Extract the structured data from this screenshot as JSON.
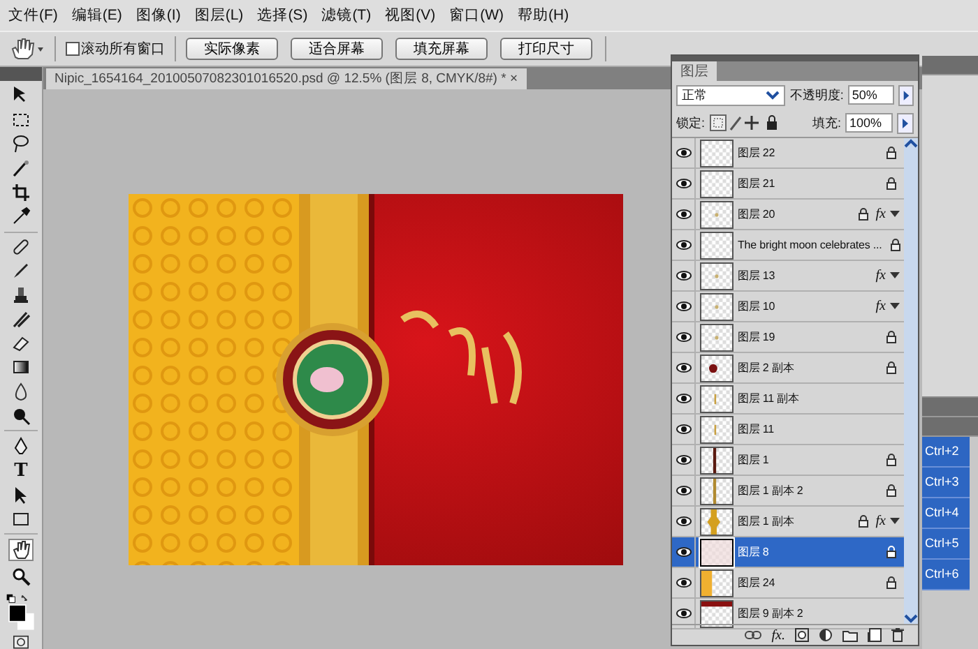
{
  "menu": [
    "文件(F)",
    "编辑(E)",
    "图像(I)",
    "图层(L)",
    "选择(S)",
    "滤镜(T)",
    "视图(V)",
    "窗口(W)",
    "帮助(H)"
  ],
  "options_bar": {
    "scroll_all": {
      "label": "滚动所有窗口",
      "checked": false
    },
    "buttons": [
      "实际像素",
      "适合屏幕",
      "填充屏幕",
      "打印尺寸"
    ]
  },
  "document_tab": {
    "title": "Nipic_1654164_20100507082301016520.psd @ 12.5% (图层 8, CMYK/8#) *",
    "close": "×"
  },
  "tools": [
    {
      "kind": "move"
    },
    {
      "kind": "marquee"
    },
    {
      "kind": "lasso"
    },
    {
      "kind": "wand"
    },
    {
      "kind": "crop"
    },
    {
      "kind": "eyedropper"
    },
    {
      "kind": "sep"
    },
    {
      "kind": "heal"
    },
    {
      "kind": "brush"
    },
    {
      "kind": "stamp"
    },
    {
      "kind": "history"
    },
    {
      "kind": "eraser"
    },
    {
      "kind": "gradient"
    },
    {
      "kind": "blur"
    },
    {
      "kind": "dodge"
    },
    {
      "kind": "sep"
    },
    {
      "kind": "pen"
    },
    {
      "kind": "type",
      "label": "T"
    },
    {
      "kind": "select"
    },
    {
      "kind": "shape"
    },
    {
      "kind": "sep"
    },
    {
      "kind": "hand",
      "selected": true
    },
    {
      "kind": "zoom",
      "selected": false
    }
  ],
  "layers_panel": {
    "title": "图层",
    "blend_mode": "正常",
    "opacity_label": "不透明度:",
    "opacity": "50%",
    "lock_label": "锁定:",
    "fill_label": "填充:",
    "fill": "100%",
    "layers": [
      {
        "name": "图层 22",
        "kind": "blank",
        "visible": true,
        "locked": true,
        "selected": false
      },
      {
        "name": "图层 21",
        "kind": "blank",
        "visible": true,
        "locked": true,
        "selected": false
      },
      {
        "name": "图层 20",
        "kind": "speck",
        "visible": true,
        "locked": true,
        "fx": "fx",
        "selected": false
      },
      {
        "name": "The bright moon celebrates ...",
        "kind": "blank",
        "visible": true,
        "locked": true,
        "selected": false
      },
      {
        "name": "图层 13",
        "kind": "speck",
        "visible": true,
        "locked": false,
        "fx": "fx",
        "selected": false
      },
      {
        "name": "图层 10",
        "kind": "speck",
        "visible": true,
        "locked": false,
        "fx": "fx",
        "selected": false
      },
      {
        "name": "图层 19",
        "kind": "speck",
        "visible": true,
        "locked": true,
        "selected": false
      },
      {
        "name": "图层 2 副本",
        "kind": "dot",
        "visible": true,
        "locked": true,
        "selected": false
      },
      {
        "name": "图层 11 副本",
        "kind": "thin",
        "visible": true,
        "locked": false,
        "selected": false
      },
      {
        "name": "图层 11",
        "kind": "thin",
        "visible": true,
        "locked": false,
        "selected": false
      },
      {
        "name": "图层 1",
        "kind": "bar-dark",
        "visible": true,
        "locked": true,
        "selected": false
      },
      {
        "name": "图层 1 副本 2",
        "kind": "bar-gold",
        "visible": true,
        "locked": true,
        "selected": false
      },
      {
        "name": "图层 1 副本",
        "kind": "gold-block",
        "visible": true,
        "locked": true,
        "fx": "fx",
        "selected": false
      },
      {
        "name": "图层 8",
        "kind": "pattern",
        "visible": true,
        "locked": true,
        "selected": true
      },
      {
        "name": "图层 24",
        "kind": "gold-left",
        "visible": true,
        "locked": true,
        "selected": false
      },
      {
        "name": "图层 9 副本 2",
        "kind": "red-top",
        "visible": true,
        "locked": false,
        "selected": false
      }
    ],
    "footer_fx": "fx."
  },
  "actions_panel": {
    "shortcuts": [
      "Ctrl+2",
      "Ctrl+3",
      "Ctrl+4",
      "Ctrl+5",
      "Ctrl+6"
    ]
  }
}
